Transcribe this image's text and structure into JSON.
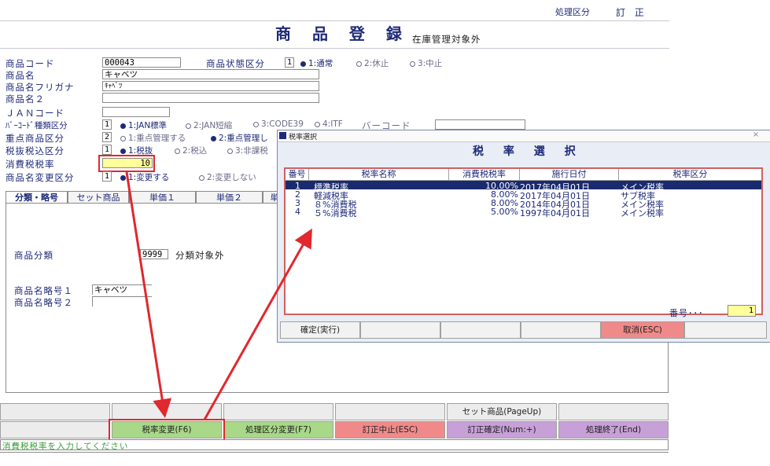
{
  "header": {
    "mode_label": "処理区分",
    "mode_value": "訂 正",
    "title": "商 品 登 録",
    "subtitle": "在庫管理対象外"
  },
  "form": {
    "code_label": "商品コード",
    "code_value": "000043",
    "status_label": "商品状態区分",
    "status_value": "1",
    "status_opts": [
      "1:通常",
      "2:休止",
      "3:中止"
    ],
    "name_label": "商品名",
    "name_value": "キャベツ",
    "kana_label": "商品名フリガナ",
    "kana_value": "ｷｬﾍﾞﾂ",
    "name2_label": "商品名２",
    "jan_label": "ＪＡＮコード",
    "barcode_type_label": "ﾊﾞｰｺｰﾄﾞ種類区分",
    "barcode_type_value": "1",
    "barcode_type_opts": [
      "1:JAN標準",
      "2:JAN短縮",
      "3:CODE39",
      "4:ITF"
    ],
    "barcode_label": "バーコード",
    "priority_label": "重点商品区分",
    "priority_value": "2",
    "priority_opts": [
      "1:重点管理する",
      "2:重点管理し"
    ],
    "tax_incl_label": "税抜税込区分",
    "tax_incl_value": "1",
    "tax_incl_opts": [
      "1:税抜",
      "2:税込",
      "3:非課税"
    ],
    "tax_rate_label": "消費税税率",
    "tax_rate_value": "10",
    "rename_label": "商品名変更区分",
    "rename_value": "1",
    "rename_opts": [
      "1:変更する",
      "2:変更しない"
    ]
  },
  "tabs": [
    "分類・略号",
    "セット商品",
    "単価１",
    "単価２",
    "単"
  ],
  "panel": {
    "category_label": "商品分類",
    "category_value": "9999",
    "category_text": "分類対象外",
    "abbr1_label": "商品名略号１",
    "abbr1_value": "キャベツ",
    "abbr2_label": "商品名略号２"
  },
  "fkeys_row1": [
    "",
    "",
    "",
    "",
    "セット商品(PageUp)",
    ""
  ],
  "fkeys_row2": [
    "",
    "税率変更(F6)",
    "処理区分変更(F7)",
    "訂正中止(ESC)",
    "訂正確定(Num:+)",
    "処理終了(End)"
  ],
  "status_message": "消費税税率を入力してください",
  "dialog": {
    "window_title": "税率選択",
    "close": "×",
    "title": "税 率 選 択",
    "headers": [
      "番号",
      "税率名称",
      "消費税税率",
      "施行日付",
      "税率区分"
    ],
    "rows": [
      {
        "no": "1",
        "name": "標準税率",
        "rate": "10.00%",
        "date": "2017年04月01日",
        "kind": "メイン税率"
      },
      {
        "no": "2",
        "name": "軽減税率",
        "rate": "8.00%",
        "date": "2017年04月01日",
        "kind": "サブ税率"
      },
      {
        "no": "3",
        "name": "８%消費税",
        "rate": "8.00%",
        "date": "2014年04月01日",
        "kind": "メイン税率"
      },
      {
        "no": "4",
        "name": "５%消費税",
        "rate": "5.00%",
        "date": "1997年04月01日",
        "kind": "メイン税率"
      }
    ],
    "number_label": "番号･･･",
    "number_value": "1",
    "buttons": [
      "確定(実行)",
      "",
      "",
      "",
      "取消(ESC)",
      ""
    ]
  },
  "colors": {
    "label": "#1e2a78",
    "selected_row": "#1a2a6e",
    "highlight_input": "#ffff99",
    "red": "#e0282e",
    "green": "#a8d888",
    "pink": "#f08a8a",
    "purple": "#c8a0d8"
  }
}
